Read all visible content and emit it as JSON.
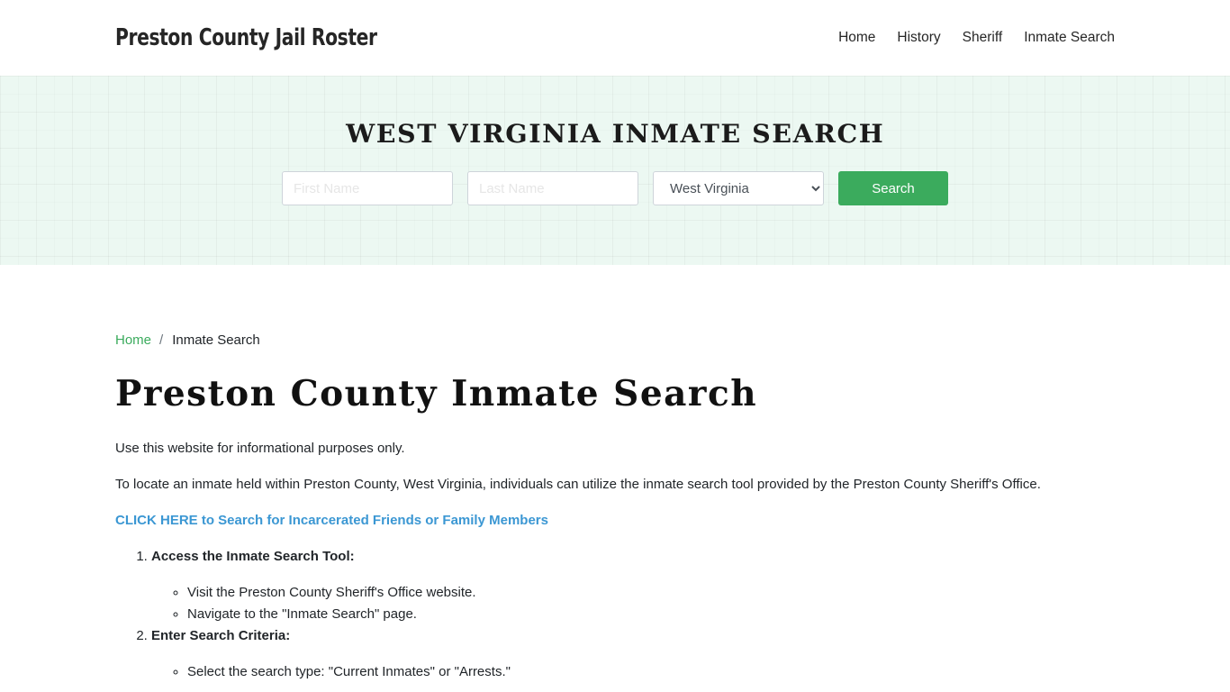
{
  "header": {
    "brand": "Preston County Jail Roster",
    "nav": [
      {
        "label": "Home"
      },
      {
        "label": "History"
      },
      {
        "label": "Sheriff"
      },
      {
        "label": "Inmate Search"
      }
    ]
  },
  "hero": {
    "title": "WEST VIRGINIA INMATE SEARCH",
    "first_name_placeholder": "First Name",
    "last_name_placeholder": "Last Name",
    "state_selected": "West Virginia",
    "search_label": "Search",
    "accent_color": "#3bab5d"
  },
  "breadcrumb": {
    "home": "Home",
    "separator": "/",
    "current": "Inmate Search"
  },
  "page": {
    "title": "Preston County Inmate Search",
    "intro": "Use this website for informational purposes only.",
    "description": "To locate an inmate held within Preston County, West Virginia, individuals can utilize the inmate search tool provided by the Preston County Sheriff's Office.",
    "cta": "CLICK HERE to Search for Incarcerated Friends or Family Members",
    "steps": [
      {
        "title": "Access the Inmate Search Tool:",
        "items": [
          "Visit the Preston County Sheriff's Office website.",
          "Navigate to the \"Inmate Search\" page."
        ]
      },
      {
        "title": "Enter Search Criteria:",
        "items": [
          "Select the search type: \"Current Inmates\" or \"Arrests.\""
        ]
      }
    ]
  }
}
